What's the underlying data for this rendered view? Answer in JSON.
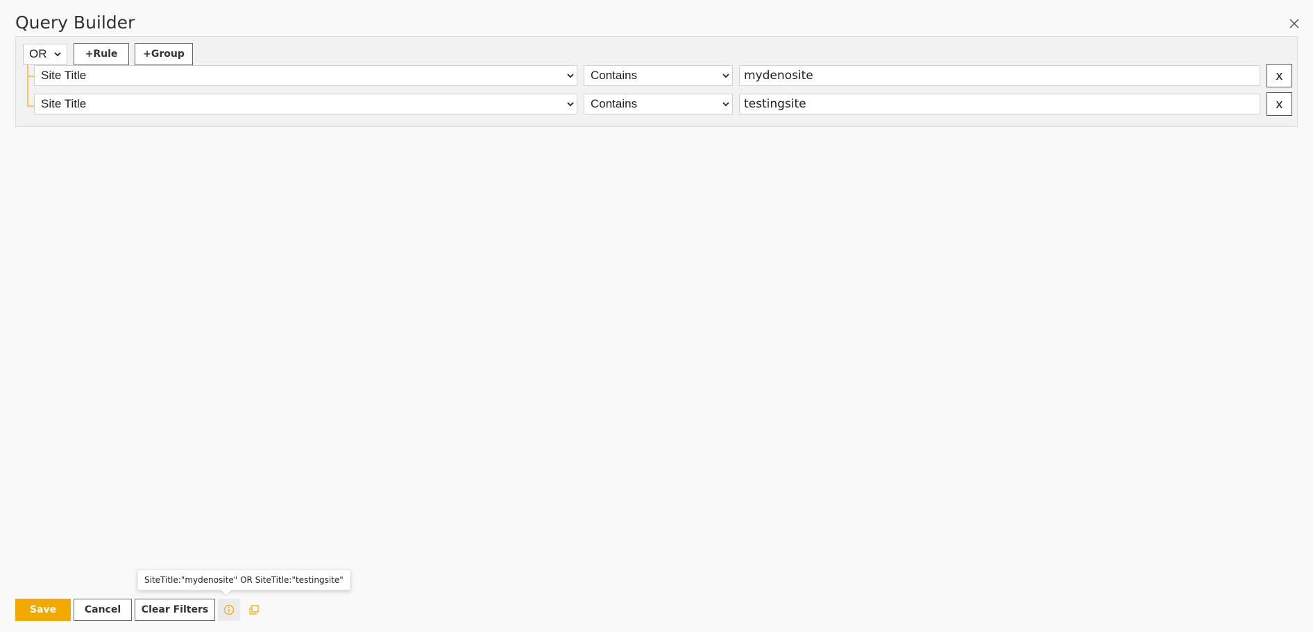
{
  "dialog": {
    "title": "Query Builder",
    "close_icon": "close-icon"
  },
  "query_builder": {
    "condition": "OR",
    "add_rule_label": "+Rule",
    "add_group_label": "+Group",
    "rules": [
      {
        "field": "Site Title",
        "operator": "Contains",
        "value": "mydenosite",
        "remove_label": "x"
      },
      {
        "field": "Site Title",
        "operator": "Contains",
        "value": "testingsite",
        "remove_label": "x"
      }
    ],
    "tree_color": "#f4c56b"
  },
  "tooltip": {
    "text": "SiteTitle:\"mydenosite\" OR SiteTitle:\"testingsite\""
  },
  "footer": {
    "save_label": "Save",
    "cancel_label": "Cancel",
    "clear_label": "Clear Filters",
    "info_icon": "info-icon",
    "copy_icon": "copy-icon",
    "accent_color": "#f2a900"
  }
}
